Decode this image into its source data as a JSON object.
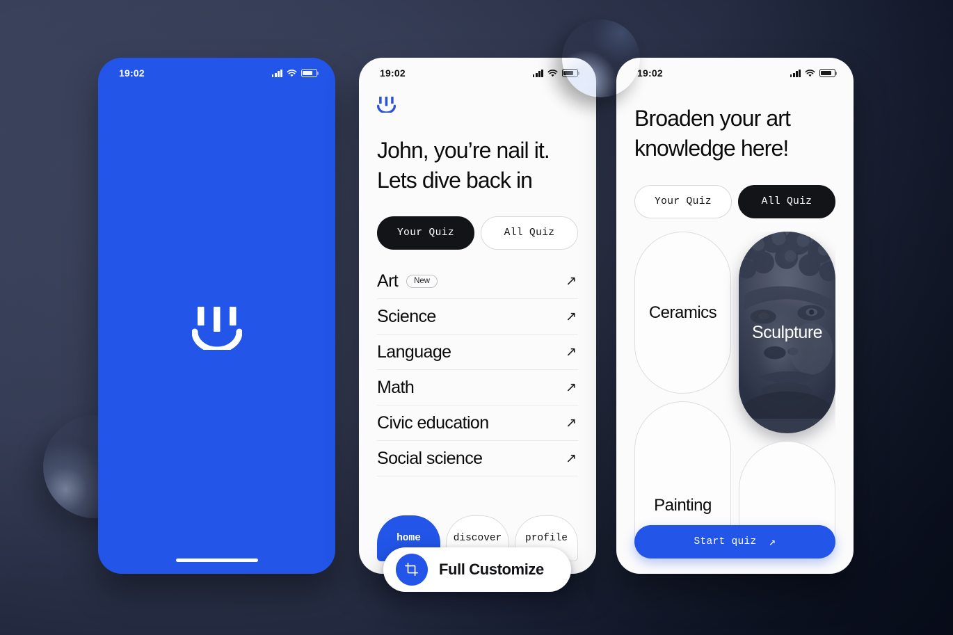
{
  "theme": {
    "brand_blue": "#2255e8",
    "dark": "#131418",
    "bg_dark_navy": "#0d1322",
    "bg_slate": "#343b53"
  },
  "status_bar": {
    "time": "19:02",
    "icons": [
      "signal-bars",
      "wifi",
      "battery"
    ]
  },
  "phone1": {
    "name": "splash-screen",
    "logo": "smiley-logo-icon",
    "background_color": "#2255e8"
  },
  "phone2": {
    "name": "your-quiz-screen",
    "logo": "smiley-logo-icon",
    "headline_line1": "John, you’re nail it.",
    "headline_line2": "Lets dive back in",
    "tabs": [
      {
        "label": "Your Quiz",
        "active": true
      },
      {
        "label": "All Quiz",
        "active": false
      }
    ],
    "subjects": [
      {
        "name": "Art",
        "badge": "New",
        "arrow": "arrow-up-right-icon"
      },
      {
        "name": "Science",
        "badge": "",
        "arrow": "arrow-up-right-icon"
      },
      {
        "name": "Language",
        "badge": "",
        "arrow": "arrow-up-right-icon"
      },
      {
        "name": "Math",
        "badge": "",
        "arrow": "arrow-up-right-icon"
      },
      {
        "name": "Civic education",
        "badge": "",
        "arrow": "arrow-up-right-icon"
      },
      {
        "name": "Social science",
        "badge": "",
        "arrow": "arrow-up-right-icon"
      }
    ],
    "bottom_nav": [
      {
        "label": "home",
        "active": true
      },
      {
        "label": "discover",
        "active": false
      },
      {
        "label": "profile",
        "active": false
      }
    ]
  },
  "customize_badge": {
    "label": "Full Customize",
    "icon": "crop-icon"
  },
  "phone3": {
    "name": "all-quiz-screen",
    "headline_line1": "Broaden your art",
    "headline_line2": "knowledge here!",
    "tabs": [
      {
        "label": "Your Quiz",
        "active": false
      },
      {
        "label": "All Quiz",
        "active": true
      }
    ],
    "cards": [
      {
        "title": "Ceramics",
        "style": "outline"
      },
      {
        "title": "Sculpture",
        "style": "image",
        "image": "marble-statue-face"
      },
      {
        "title": "Painting",
        "style": "outline"
      },
      {
        "title": "",
        "style": "outline"
      }
    ],
    "cta": {
      "label": "Start quiz",
      "icon": "arrow-up-right-icon"
    }
  }
}
